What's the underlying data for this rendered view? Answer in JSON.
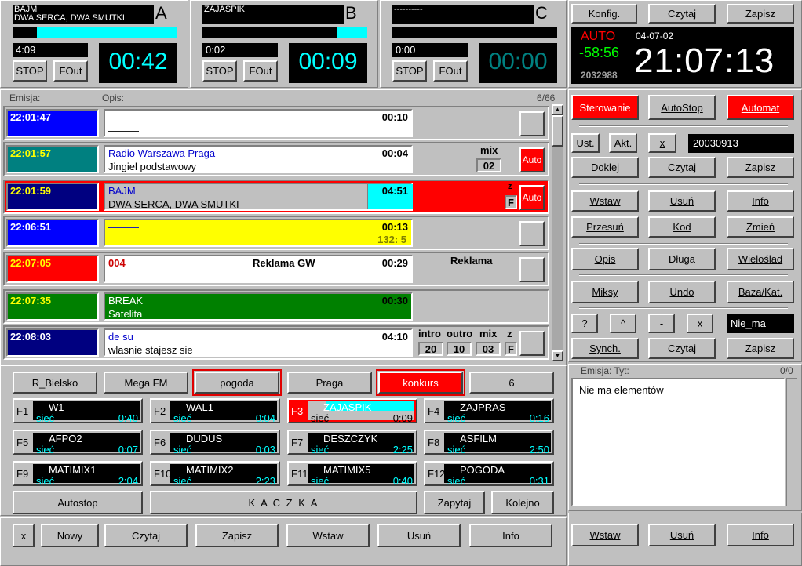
{
  "players": [
    {
      "letter": "A",
      "title1": "BAJM",
      "title2": "DWA SERCA, DWA SMUTKI",
      "progress": 0.85,
      "elapsed": "4:09",
      "remain": "00:42",
      "stop": "STOP",
      "fout": "FOut"
    },
    {
      "letter": "B",
      "title1": "ZAJASPIK",
      "title2": "",
      "progress": 0.18,
      "elapsed": "0:02",
      "remain": "00:09",
      "stop": "STOP",
      "fout": "FOut"
    },
    {
      "letter": "C",
      "title1": "----------",
      "title2": "",
      "progress": 0.0,
      "elapsed": "0:00",
      "remain": "00:00",
      "stop": "STOP",
      "fout": "FOut"
    }
  ],
  "top_right": {
    "konfig": "Konfig.",
    "czytaj": "Czytaj",
    "zapisz": "Zapisz"
  },
  "clock": {
    "mode": "AUTO",
    "date": "04-07-02",
    "offset": "-58:56",
    "time": "21:07:13",
    "counter": "2032988"
  },
  "playlist": {
    "header_emisja": "Emisja:",
    "header_opis": "Opis:",
    "count": "6/66",
    "rows": [
      {
        "time": "22:01:47",
        "line1": "———",
        "line2": "———",
        "dur": "00:10"
      },
      {
        "time": "22:01:57",
        "line1": "Radio Warszawa Praga",
        "line2": "Jingiel podstawowy",
        "dur": "00:04",
        "extra": "mix",
        "extra_val": "02",
        "auto": "Auto"
      },
      {
        "time": "22:01:59",
        "line1": "BAJM",
        "line2": "DWA SERCA, DWA SMUTKI",
        "dur": "04:51",
        "z": "z",
        "f": "F",
        "auto": "Auto"
      },
      {
        "time": "22:06:51",
        "line1": "———",
        "line2": "———",
        "dur": "00:13",
        "sub": "132: 5"
      },
      {
        "time": "22:07:05",
        "line1": "004",
        "mid": "Reklama GW",
        "dur": "00:29",
        "extra": "Reklama"
      },
      {
        "time": "22:07:35",
        "line1": "BREAK",
        "line2": "Satelita",
        "dur": "00:30"
      },
      {
        "time": "22:08:03",
        "line1": "de su",
        "line2": "wlasnie stajesz sie",
        "dur": "04:10",
        "labels": [
          "intro",
          "outro",
          "mix",
          "z"
        ],
        "vals": [
          "20",
          "10",
          "03",
          "F"
        ]
      }
    ]
  },
  "right_panel": {
    "sterowanie": "Sterowanie",
    "autostop": "AutoStop",
    "automat": "Automat",
    "ust": "Ust.",
    "akt": "Akt.",
    "x": "x",
    "date_field": "20030913",
    "doklej": "Doklej",
    "czytaj": "Czytaj",
    "zapisz": "Zapisz",
    "wstaw": "Wstaw",
    "usun": "Usuń",
    "info": "Info",
    "przesun": "Przesuń",
    "kod": "Kod",
    "zmien": "Zmień",
    "opis": "Opis",
    "dluga": "Długa",
    "wieloslad": "Wieloślad",
    "miksy": "Miksy",
    "undo": "Undo",
    "baza": "Baza/Kat.",
    "q": "?",
    "caret": "^",
    "minus": "-",
    "x2": "x",
    "nie_ma": "Nie_ma",
    "synch": "Synch.",
    "czytaj2": "Czytaj",
    "zapisz2": "Zapisz",
    "emisja_tyt": "Emisja: Tyt:",
    "emisja_count": "0/0",
    "empty_msg": "Nie ma elementów",
    "bottom": [
      "Wstaw",
      "Usuń",
      "Info"
    ]
  },
  "groups": [
    "R_Bielsko",
    "Mega FM",
    "pogoda",
    "Praga",
    "konkurs",
    "6"
  ],
  "fkeys": [
    {
      "key": "F1",
      "name": "W1",
      "src": "sieć",
      "dur": "0:40"
    },
    {
      "key": "F2",
      "name": "WAL1",
      "src": "sieć",
      "dur": "0:04"
    },
    {
      "key": "F3",
      "name": "ZAJASPIK",
      "src": "sieć",
      "dur": "0:09"
    },
    {
      "key": "F4",
      "name": "ZAJPRAS",
      "src": "sieć",
      "dur": "0:16"
    },
    {
      "key": "F5",
      "name": "AFPO2",
      "src": "sieć",
      "dur": "0:07"
    },
    {
      "key": "F6",
      "name": "DUDUS",
      "src": "sieć",
      "dur": "0:03"
    },
    {
      "key": "F7",
      "name": "DESZCZYK",
      "src": "sieć",
      "dur": "2:25"
    },
    {
      "key": "F8",
      "name": "ASFILM",
      "src": "sieć",
      "dur": "2:50"
    },
    {
      "key": "F9",
      "name": "MATIMIX1",
      "src": "sieć",
      "dur": "2:04"
    },
    {
      "key": "F10",
      "name": "MATIMIX2",
      "src": "sieć",
      "dur": "2:23"
    },
    {
      "key": "F11",
      "name": "MATIMIX5",
      "src": "sieć",
      "dur": "0:40"
    },
    {
      "key": "F12",
      "name": "POGODA",
      "src": "sieć",
      "dur": "0:31"
    }
  ],
  "bottom_left": {
    "autostop": "Autostop",
    "kaczka": "K A C Z K A",
    "zapytaj": "Zapytaj",
    "kolejno": "Kolejno"
  },
  "toolbar": [
    "x",
    "Nowy",
    "Czytaj",
    "Zapisz",
    "Wstaw",
    "Usuń",
    "Info"
  ]
}
